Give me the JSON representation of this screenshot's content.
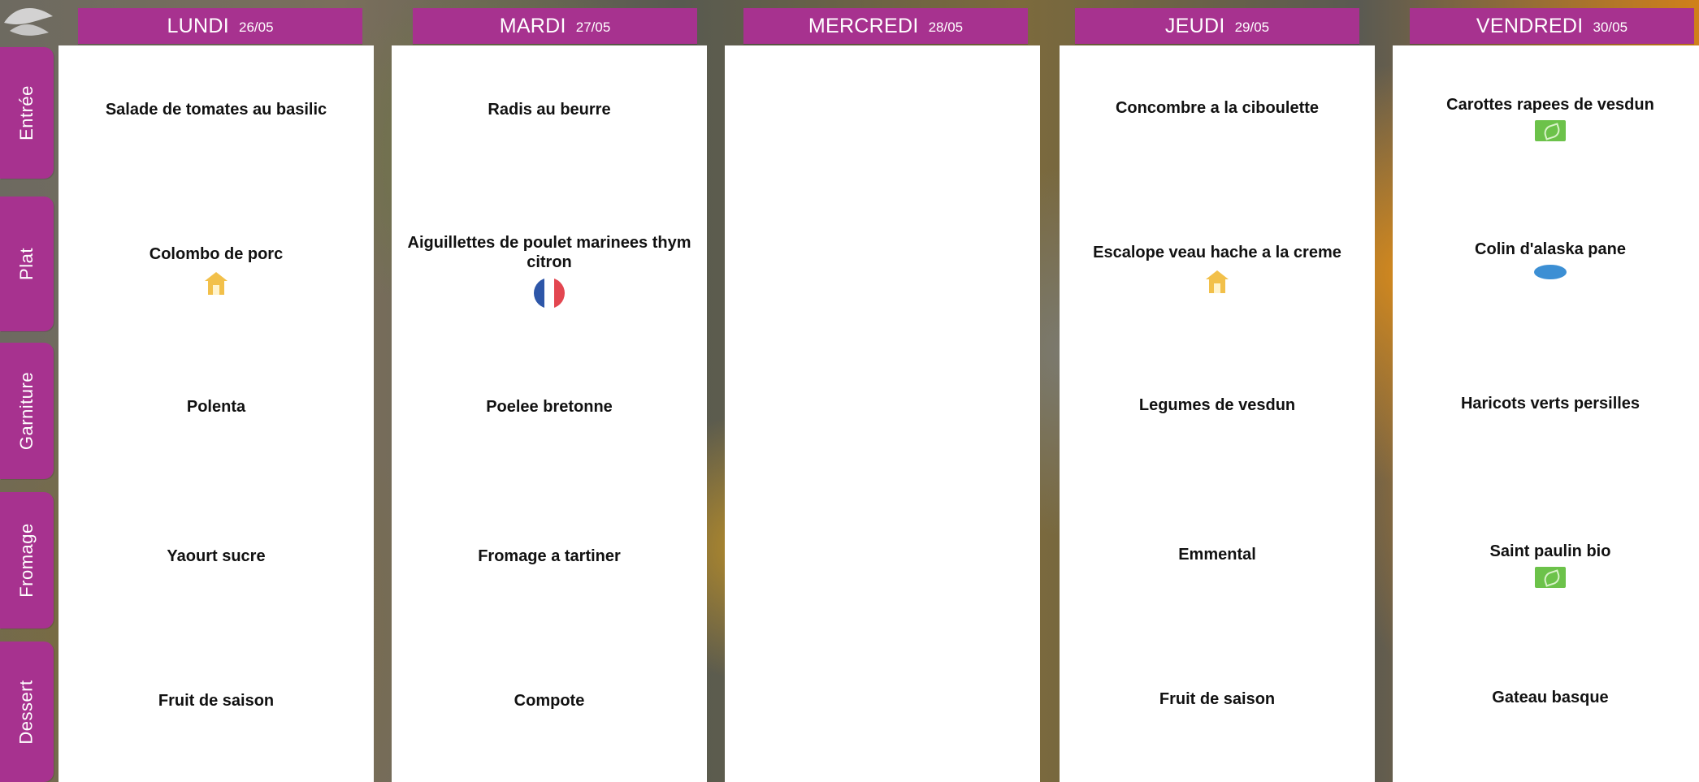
{
  "days": [
    {
      "name": "LUNDI",
      "date": "26/05"
    },
    {
      "name": "MARDI",
      "date": "27/05"
    },
    {
      "name": "MERCREDI",
      "date": "28/05"
    },
    {
      "name": "JEUDI",
      "date": "29/05"
    },
    {
      "name": "VENDREDI",
      "date": "30/05"
    }
  ],
  "categories": [
    "Entrée",
    "Plat",
    "Garniture",
    "Fromage",
    "Dessert"
  ],
  "menu": {
    "lundi": {
      "entree": "Salade de tomates au basilic",
      "plat": "Colombo de porc",
      "garniture": "Polenta",
      "fromage": "Yaourt sucre",
      "dessert": "Fruit de saison"
    },
    "mardi": {
      "entree": "Radis au beurre",
      "plat": "Aiguillettes de poulet marinees thym citron",
      "garniture": "Poelee bretonne",
      "fromage": "Fromage a tartiner",
      "dessert": "Compote"
    },
    "mercredi": {
      "entree": "",
      "plat": "",
      "garniture": "",
      "fromage": "",
      "dessert": ""
    },
    "jeudi": {
      "entree": "Concombre a la ciboulette",
      "plat": "Escalope veau hache a la creme",
      "garniture": "Legumes de vesdun",
      "fromage": "Emmental",
      "dessert": "Fruit de saison"
    },
    "vendredi": {
      "entree": "Carottes rapees de vesdun",
      "plat": "Colin d'alaska pane",
      "garniture": "Haricots verts persilles",
      "fromage": "Saint paulin bio",
      "dessert": "Gateau basque"
    }
  },
  "badges": {
    "lundi_plat": "house-icon",
    "mardi_plat": "french-flag-icon",
    "jeudi_plat": "house-icon",
    "vendredi_entree": "bio-leaf-icon",
    "vendredi_plat": "fish-icon",
    "vendredi_fromage": "bio-leaf-icon"
  },
  "colors": {
    "accent": "#a7328f",
    "card": "#ffffff",
    "text": "#111111",
    "bio": "#6cc24a",
    "fish": "#3c8fd4",
    "house": "#f2c04a"
  }
}
